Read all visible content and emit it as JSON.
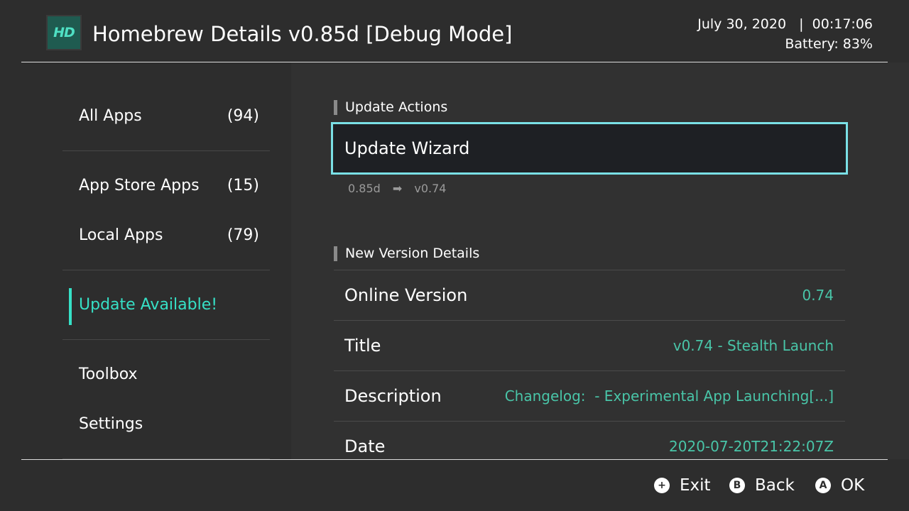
{
  "header": {
    "logo_text": "HD",
    "title": "Homebrew Details v0.85d [Debug Mode]",
    "datetime": "July 30, 2020   |  00:17:06",
    "battery": "Battery: 83%"
  },
  "sidebar": {
    "items": [
      {
        "label": "All Apps",
        "count": "(94)"
      },
      {
        "label": "App Store Apps",
        "count": "(15)"
      },
      {
        "label": "Local Apps",
        "count": "(79)"
      },
      {
        "label": "Update Available!",
        "count": ""
      },
      {
        "label": "Toolbox",
        "count": ""
      },
      {
        "label": "Settings",
        "count": ""
      }
    ],
    "active_color": "#36e0c6"
  },
  "main": {
    "update_actions_header": "Update Actions",
    "wizard_label": "Update Wizard",
    "current_version": "0.85d",
    "arrow": "➡",
    "target_version": "v0.74",
    "details_header": "New Version Details",
    "rows": [
      {
        "key": "Online Version",
        "value": "0.74"
      },
      {
        "key": "Title",
        "value": "v0.74 - Stealth Launch"
      },
      {
        "key": "Description",
        "value": "Changelog:  - Experimental App Launching[...]"
      },
      {
        "key": "Date",
        "value": "2020-07-20T21:22:07Z"
      }
    ],
    "value_color": "#49c5a8",
    "focus_color": "#7ae0e6"
  },
  "footer": {
    "buttons": [
      {
        "glyph": "+",
        "label": "Exit",
        "icon": "plus-button-icon"
      },
      {
        "glyph": "B",
        "label": "Back",
        "icon": "b-button-icon"
      },
      {
        "glyph": "A",
        "label": "OK",
        "icon": "a-button-icon"
      }
    ]
  }
}
